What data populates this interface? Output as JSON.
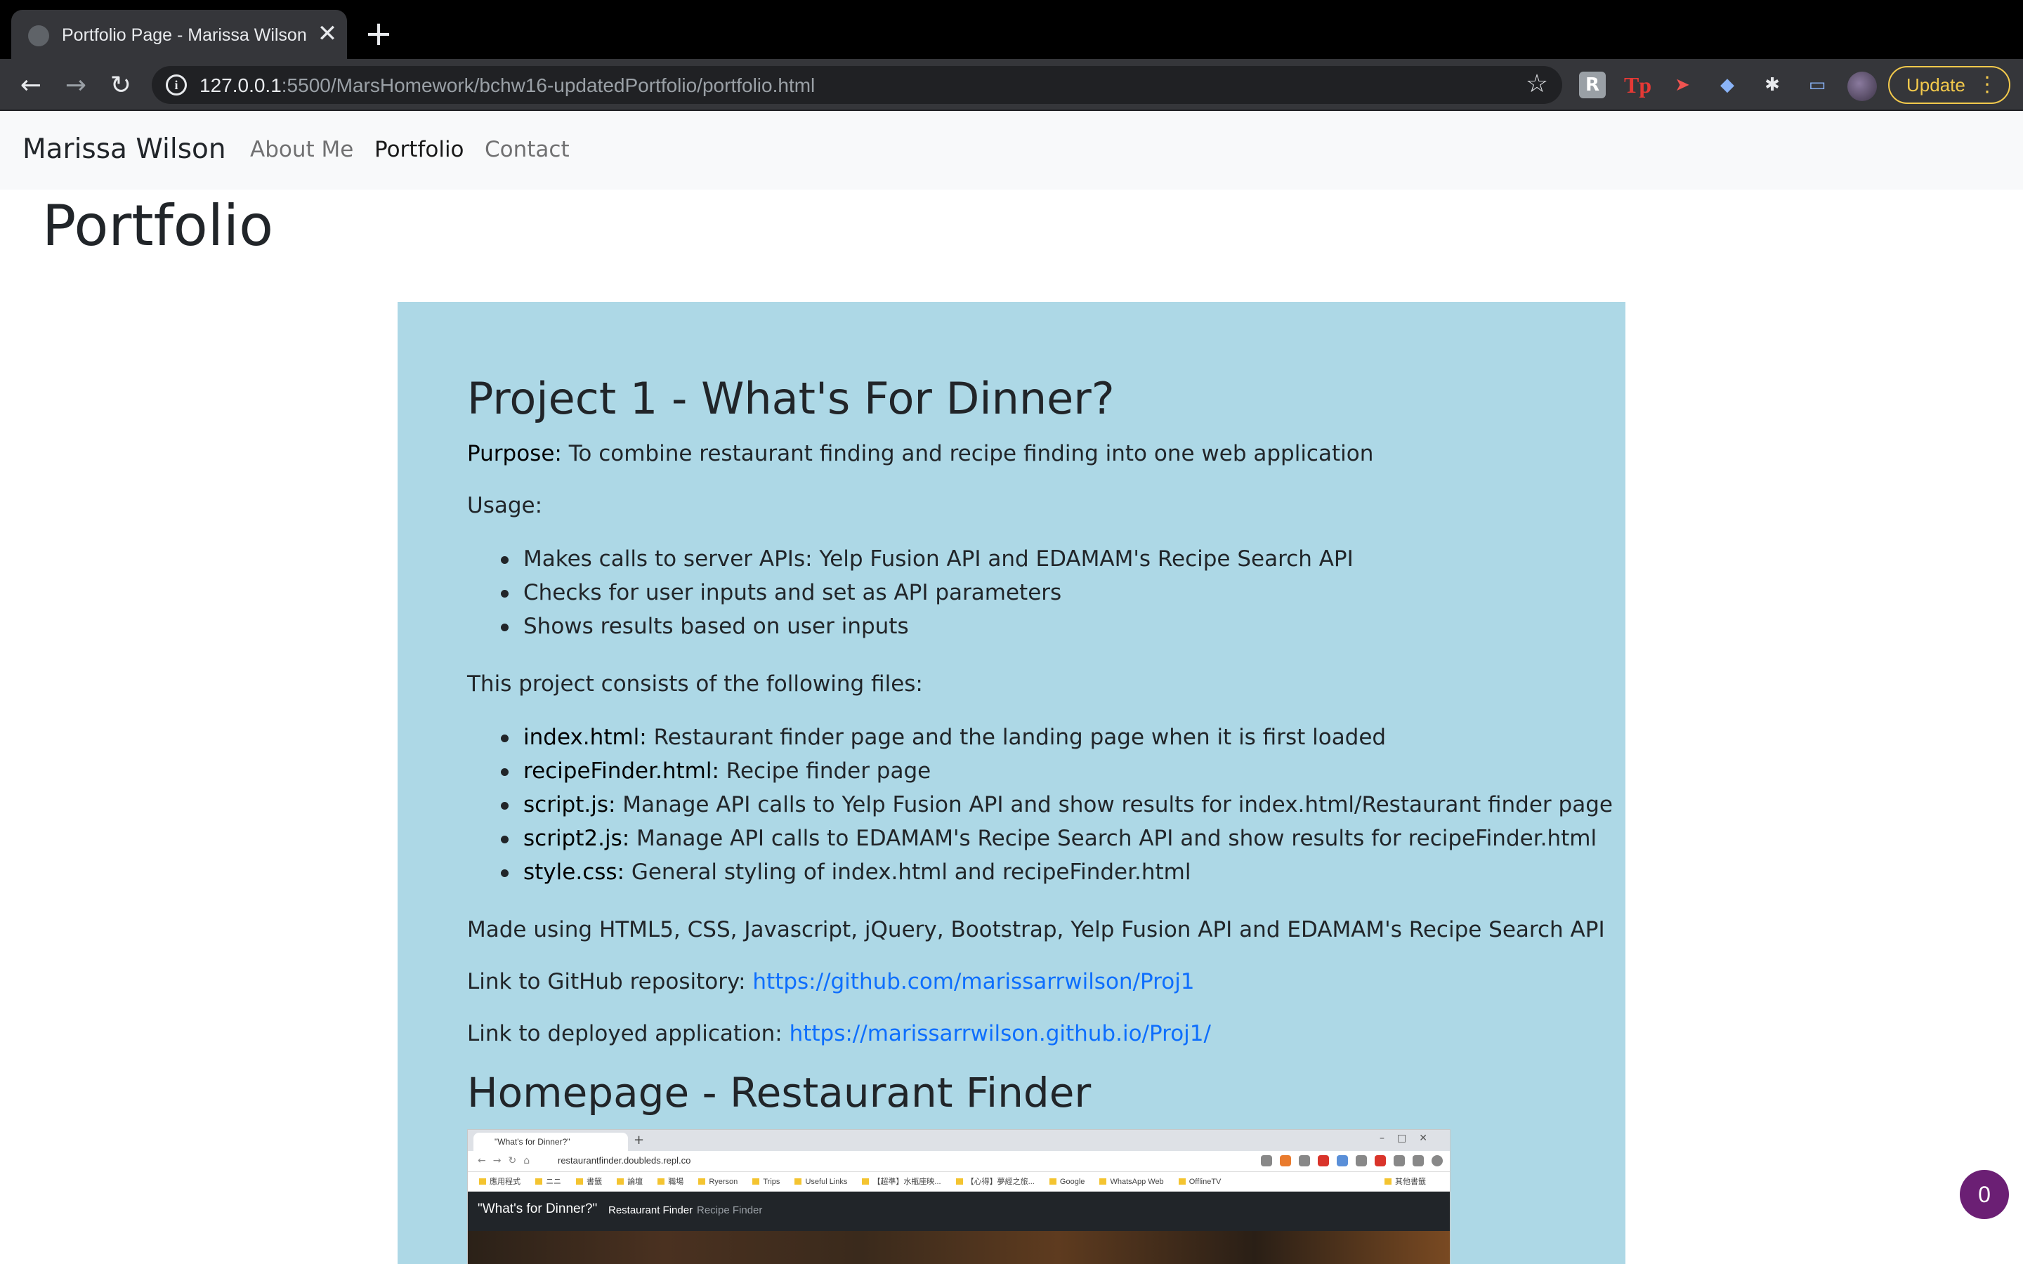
{
  "browser": {
    "tab_title": "Portfolio Page - Marissa Wilson",
    "url_host": "127.0.0.1",
    "url_path": ":5500/MarsHomework/bchw16-updatedPortfolio/portfolio.html",
    "update_label": "Update",
    "icons": [
      "back-arrow-icon",
      "forward-arrow-icon",
      "reload-icon",
      "info-icon",
      "star-icon",
      "extension-icon",
      "profile-avatar",
      "more-icon"
    ]
  },
  "navbar": {
    "brand": "Marissa Wilson",
    "links": [
      "About Me",
      "Portfolio",
      "Contact"
    ],
    "active": "Portfolio"
  },
  "page": {
    "title": "Portfolio"
  },
  "project": {
    "title": "Project 1 - What's For Dinner?",
    "purpose_label": "Purpose:",
    "purpose_text": " To combine restaurant finding and recipe finding into one web application",
    "usage_label": "Usage:",
    "usage_items": [
      "Makes calls to server APIs: Yelp Fusion API and EDAMAM's Recipe Search API",
      "Checks for user inputs and set as API parameters",
      "Shows results based on user inputs"
    ],
    "files_intro": "This project consists of the following files:",
    "files": [
      {
        "name": "index.html:",
        "desc": " Restaurant finder page and the landing page when it is first loaded"
      },
      {
        "name": "recipeFinder.html:",
        "desc": " Recipe finder page"
      },
      {
        "name": "script.js:",
        "desc": " Manage API calls to Yelp Fusion API and show results for index.html/Restaurant finder page"
      },
      {
        "name": "script2.js:",
        "desc": " Manage API calls to EDAMAM's Recipe Search API and show results for recipeFinder.html"
      },
      {
        "name": "style.css:",
        "desc": " General styling of index.html and recipeFinder.html"
      }
    ],
    "made_using": "Made using HTML5, CSS, Javascript, jQuery, Bootstrap, Yelp Fusion API and EDAMAM's Recipe Search API",
    "github_label": "Link to GitHub repository: ",
    "github_url": "https://github.com/marissarrwilson/Proj1",
    "deployed_label": "Link to deployed application: ",
    "deployed_url": "https://marissarrwilson.github.io/Proj1/",
    "section_title": "Homepage - Restaurant Finder"
  },
  "screenshot": {
    "tab_title": "\"What's for Dinner?\"",
    "url": "restaurantfinder.doubleds.repl.co",
    "bookmarks": [
      "應用程式",
      "ニニ",
      "書籤",
      "論壇",
      "職場",
      "Ryerson",
      "Trips",
      "Useful Links",
      "【超準】水瓶座映...",
      "【心得】夢經之旅...",
      "Google",
      "WhatsApp Web",
      "OfflineTV"
    ],
    "bookmarks_right": "其他書籤",
    "app_brand": "\"What's for Dinner?\"",
    "app_link_1": "Restaurant Finder",
    "app_link_2": "Recipe Finder"
  },
  "counter_badge": "0",
  "colors": {
    "card_bg": "#add8e6",
    "link": "#0d6efd",
    "counter_bg": "#6b1f74",
    "update_accent": "#f2c94c"
  }
}
